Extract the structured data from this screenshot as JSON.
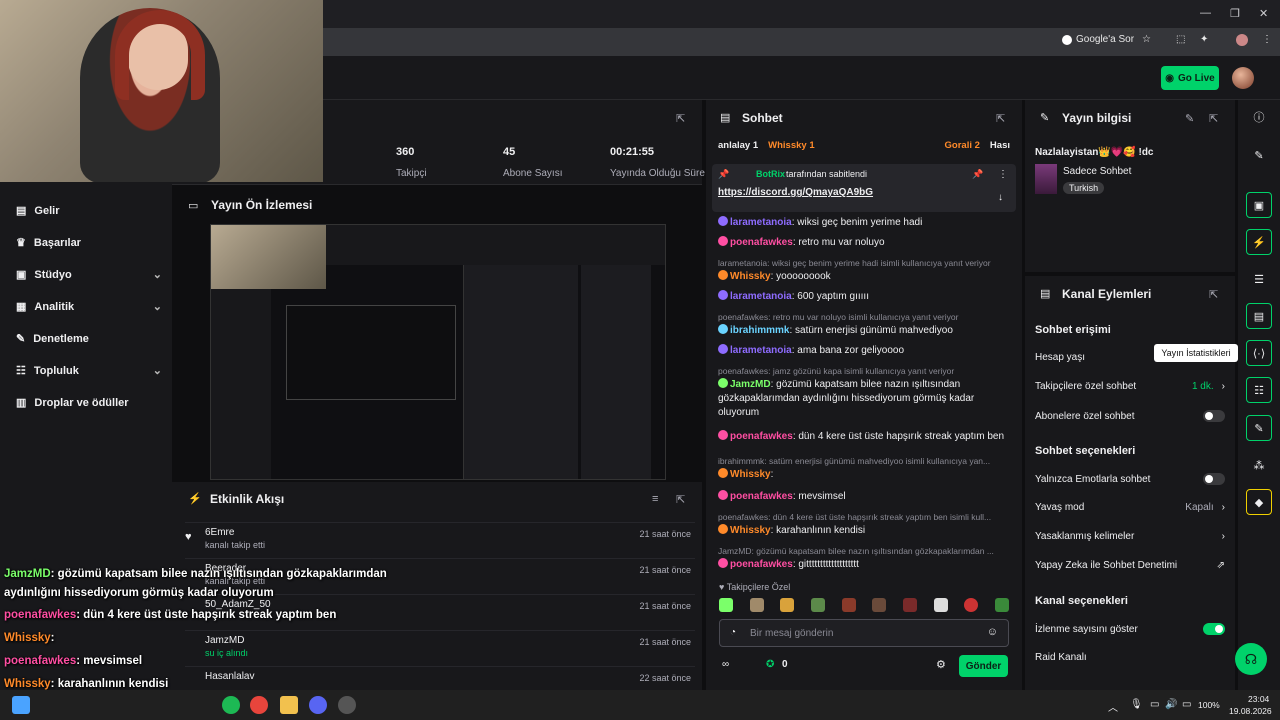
{
  "browser": {
    "google_ask": "Google'a Sor"
  },
  "header": {
    "golive": "Go Live"
  },
  "nav": {
    "items": [
      {
        "label": "Gelir",
        "chev": ""
      },
      {
        "label": "Başarılar",
        "chev": ""
      },
      {
        "label": "Stüdyo",
        "chev": "⌄"
      },
      {
        "label": "Analitik",
        "chev": "⌄"
      },
      {
        "label": "Denetleme",
        "chev": ""
      },
      {
        "label": "Topluluk",
        "chev": "⌄"
      },
      {
        "label": "Droplar ve ödüller",
        "chev": ""
      }
    ]
  },
  "stats": [
    {
      "value": "360",
      "label": "Takipçi"
    },
    {
      "value": "45",
      "label": "Abone Sayısı"
    },
    {
      "value": "00:21:55",
      "label": "Yayında Olduğu Süre"
    }
  ],
  "preview": {
    "title": "Yayın Ön İzlemesi"
  },
  "activity": {
    "title": "Etkinlik Akışı",
    "rows": [
      {
        "name": "6Emre",
        "sub": "kanalı takip etti",
        "time": "21 saat önce"
      },
      {
        "name": "Beerader",
        "sub": "kanalı takip etti",
        "time": "21 saat önce"
      },
      {
        "name": "50_AdamZ_50",
        "sub": "",
        "time": "21 saat önce"
      },
      {
        "name": "JamzMD",
        "sub": "su iç alındı",
        "time": "21 saat önce"
      },
      {
        "name": "Hasanlalav",
        "sub": "",
        "time": "22 saat önce"
      }
    ]
  },
  "chat": {
    "title": "Sohbet",
    "top_users": [
      "anlalay 1",
      "Whissky 1",
      "Gorali 2",
      "Hası"
    ],
    "pinned_by": "BotRix",
    "pinned_by_suffix": "tarafından sabitlendi",
    "pinned_link": "https://discord.gg/QmayaQA9bG",
    "lines": [
      {
        "type": "msg",
        "user": "larametanoia",
        "color": "#8e6cff",
        "text": "wiksi geç benim yerime hadi"
      },
      {
        "type": "msg",
        "user": "poenafawkes",
        "color": "#ff4fa3",
        "text": "retro mu var noluyo"
      },
      {
        "type": "reply",
        "text": "larametanoia: wiksi geç benim yerime hadi isimli kullanıcıya yanıt veriyor"
      },
      {
        "type": "msg",
        "user": "Whissky",
        "color": "#ff8a2a",
        "text": "yooooooook"
      },
      {
        "type": "msg",
        "user": "larametanoia",
        "color": "#8e6cff",
        "text": "600 yaptım gııııı"
      },
      {
        "type": "reply",
        "text": "poenafawkes: retro mu var noluyo isimli kullanıcıya yanıt veriyor"
      },
      {
        "type": "msg",
        "user": "ibrahimmmk",
        "color": "#6ad3ff",
        "text": "satürn enerjisi günümü mahvediyoo"
      },
      {
        "type": "msg",
        "user": "larametanoia",
        "color": "#8e6cff",
        "text": "ama bana zor geliyoooo"
      },
      {
        "type": "reply",
        "text": "poenafawkes: jamz gözünü kapa isimli kullanıcıya yanıt veriyor"
      },
      {
        "type": "msg2",
        "user": "JamzMD",
        "color": "#7bff6a",
        "text": "gözümü kapatsam bilee nazın ışıltısından gözkapaklarımdan aydınlığını hissediyorum görmüş kadar oluyorum"
      },
      {
        "type": "msg2",
        "user": "poenafawkes",
        "color": "#ff4fa3",
        "text": "dün 4 kere üst üste hapşırık streak yaptım ben"
      },
      {
        "type": "reply",
        "text": "ibrahimmmk: satürn enerjisi günümü mahvediyoo isimli kullanıcıya yan..."
      },
      {
        "type": "msg",
        "user": "Whissky",
        "color": "#ff8a2a",
        "text": ""
      },
      {
        "type": "msg",
        "user": "poenafawkes",
        "color": "#ff4fa3",
        "text": "mevsimsel"
      },
      {
        "type": "reply",
        "text": "poenafawkes: dün 4 kere üst üste hapşırık streak yaptım ben isimli kull..."
      },
      {
        "type": "msg",
        "user": "Whissky",
        "color": "#ff8a2a",
        "text": "karahanlının kendisi"
      },
      {
        "type": "reply",
        "text": "JamzMD: gözümü kapatsam bilee nazın ışıltısından gözkapaklarımdan ..."
      },
      {
        "type": "msg",
        "user": "poenafawkes",
        "color": "#ff4fa3",
        "text": "gittttttttttttttttttt"
      }
    ],
    "follower_only_label": "Takipçilere Özel",
    "input_placeholder": "Bir mesaj gönderin",
    "points": "0",
    "send": "Gönder"
  },
  "stream_info": {
    "title": "Yayın bilgisi",
    "stream_title": "Nazlalayistan👑💗🥰 !dc",
    "category": "Sadece Sohbet",
    "language": "Turkish"
  },
  "channel_actions": {
    "title": "Kanal Eylemleri",
    "chat_access": "Sohbet erişimi",
    "account_age": "Hesap yaşı",
    "follower_chat": "Takipçilere özel sohbet",
    "follower_chat_value": "1 dk.",
    "sub_chat": "Abonelere özel sohbet",
    "chat_options": "Sohbet seçenekleri",
    "emote_only": "Yalnızca Emotlarla sohbet",
    "slow_mode": "Yavaş mod",
    "slow_mode_value": "Kapalı",
    "banned_words": "Yasaklanmış kelimeler",
    "ai_moderation": "Yapay Zeka ile Sohbet Denetimi",
    "channel_options": "Kanal seçenekleri",
    "show_viewers": "İzlenme sayısını göster",
    "raid": "Raid Kanalı"
  },
  "tooltip": "Yayın İstatistikleri",
  "overlay": [
    {
      "user": "JamzMD",
      "color": "#7bff6a",
      "text": ": gözümü kapatsam bilee nazın ışıltısından gözkapaklarımdan"
    },
    {
      "user": "",
      "color": "#fff",
      "text": "aydınlığını hissediyorum görmüş kadar oluyorum"
    },
    {
      "user": "poenafawkes",
      "color": "#ff4fa3",
      "text": ": dün 4 kere üst üste hapşırık streak yaptım ben"
    },
    {
      "user": "Whissky",
      "color": "#ff8a2a",
      "text": ":"
    },
    {
      "user": "poenafawkes",
      "color": "#ff4fa3",
      "text": ": mevsimsel"
    },
    {
      "user": "Whissky",
      "color": "#ff8a2a",
      "text": ": karahanlının kendisi"
    },
    {
      "user": "poenafawkes",
      "color": "#ff4fa3",
      "text": ": gitttttttttttttttttt"
    }
  ],
  "taskbar": {
    "time": "23:04",
    "date": "19.08.2026",
    "battery": "100%"
  },
  "colors": {
    "accent": "#00d26a",
    "bg": "#0e0e10",
    "panel": "#18181b"
  }
}
